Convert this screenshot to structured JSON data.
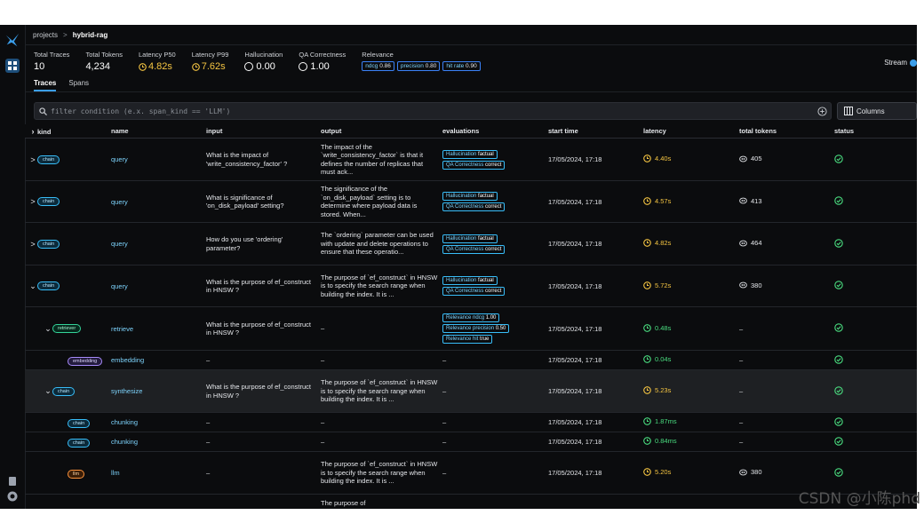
{
  "breadcrumb": {
    "root": "projects",
    "separator": ">",
    "current": "hybrid-rag"
  },
  "stats": [
    {
      "label": "Total Traces",
      "value": "10",
      "icon": "",
      "style": "plain"
    },
    {
      "label": "Total Tokens",
      "value": "4,234",
      "icon": "",
      "style": "plain"
    },
    {
      "label": "Latency P50",
      "value": "4.82s",
      "icon": "clock-icon",
      "style": "warn"
    },
    {
      "label": "Latency P99",
      "value": "7.62s",
      "icon": "clock-icon",
      "style": "warn"
    },
    {
      "label": "Hallucination",
      "value": "0.00",
      "icon": "ring-icon",
      "style": "plain"
    },
    {
      "label": "QA Correctness",
      "value": "1.00",
      "icon": "ring-icon",
      "style": "plain"
    }
  ],
  "relevance": {
    "label": "Relevance",
    "chips": [
      {
        "name": "ndcg",
        "value": "0.86"
      },
      {
        "name": "precision",
        "value": "0.80"
      },
      {
        "name": "hit rate",
        "value": "0.90"
      }
    ]
  },
  "stream_label": "Stream",
  "tabs": [
    {
      "label": "Traces",
      "active": true
    },
    {
      "label": "Spans",
      "active": false
    }
  ],
  "filter": {
    "placeholder": "filter condition (e.x. span_kind == 'LLM')"
  },
  "columns_button": "Columns",
  "table": {
    "headers": [
      "kind",
      "name",
      "input",
      "output",
      "evaluations",
      "start time",
      "latency",
      "total tokens",
      "status"
    ],
    "rows": [
      {
        "indent": 0,
        "caret": ">",
        "kind": "chain",
        "name": "query",
        "input": "What is the impact of 'write_consistency_factor' ?",
        "output": "The impact of the `write_consistency_factor` is that it defines the number of replicas that must ack...",
        "evals": [
          {
            "name": "Hallucination",
            "value": "factual"
          },
          {
            "name": "QA Correctness",
            "value": "correct"
          }
        ],
        "start": "17/05/2024, 17:18",
        "latency": "4.40s",
        "latency_style": "warn",
        "tokens": "405",
        "height": 48
      },
      {
        "indent": 0,
        "caret": ">",
        "kind": "chain",
        "name": "query",
        "input": "What is significance of 'on_disk_payload' setting?",
        "output": "The significance of the `on_disk_payload` setting is to determine where payload data is stored. When...",
        "evals": [
          {
            "name": "Hallucination",
            "value": "factual"
          },
          {
            "name": "QA Correctness",
            "value": "correct"
          }
        ],
        "start": "17/05/2024, 17:18",
        "latency": "4.57s",
        "latency_style": "warn",
        "tokens": "413",
        "height": 47
      },
      {
        "indent": 0,
        "caret": ">",
        "kind": "chain",
        "name": "query",
        "input": "How do you use 'ordering' parameter?",
        "output": "The `ordering` parameter can be used with update and delete operations to ensure that these operatio...",
        "evals": [
          {
            "name": "Hallucination",
            "value": "factual"
          },
          {
            "name": "QA Correctness",
            "value": "correct"
          }
        ],
        "start": "17/05/2024, 17:18",
        "latency": "4.82s",
        "latency_style": "warn",
        "tokens": "464",
        "height": 48
      },
      {
        "indent": 0,
        "caret": "⌄",
        "kind": "chain",
        "name": "query",
        "input": "What is the purpose of ef_construct in HNSW ?",
        "output": "The purpose of `ef_construct` in HNSW is to specify the search range when building the index. It is ...",
        "evals": [
          {
            "name": "Hallucination",
            "value": "factual"
          },
          {
            "name": "QA Correctness",
            "value": "correct"
          }
        ],
        "start": "17/05/2024, 17:18",
        "latency": "5.72s",
        "latency_style": "warn",
        "tokens": "380",
        "height": 47
      },
      {
        "indent": 1,
        "caret": "⌄",
        "kind": "retriever",
        "name": "retrieve",
        "input": "What is the purpose of ef_construct in HNSW ?",
        "output": "–",
        "evals": [
          {
            "name": "Relevance ndcg",
            "value": "1.00"
          },
          {
            "name": "Relevance precision",
            "value": "0.50"
          },
          {
            "name": "Relevance hit",
            "value": "true"
          }
        ],
        "start": "17/05/2024, 17:18",
        "latency": "0.48s",
        "latency_style": "ok",
        "tokens": "–",
        "height": 49
      },
      {
        "indent": 2,
        "caret": "",
        "kind": "embedding",
        "name": "embedding",
        "input": "–",
        "output": "–",
        "evals": [
          {
            "name": "",
            "value": "–"
          }
        ],
        "start": "17/05/2024, 17:18",
        "latency": "0.04s",
        "latency_style": "ok",
        "tokens": "–",
        "height": 22
      },
      {
        "indent": 1,
        "caret": "⌄",
        "kind": "chain",
        "name": "synthesize",
        "input": "What is the purpose of ef_construct in HNSW ?",
        "output": "The purpose of `ef_construct` in HNSW is to specify the search range when building the index. It is ...",
        "evals": [
          {
            "name": "",
            "value": "–"
          }
        ],
        "start": "17/05/2024, 17:18",
        "latency": "5.23s",
        "latency_style": "warn",
        "tokens": "–",
        "height": 48,
        "highlight": true
      },
      {
        "indent": 2,
        "caret": "",
        "kind": "chain",
        "name": "chunking",
        "input": "–",
        "output": "–",
        "evals": [
          {
            "name": "",
            "value": "–"
          }
        ],
        "start": "17/05/2024, 17:18",
        "latency": "1.87ms",
        "latency_style": "ok",
        "tokens": "–",
        "height": 22
      },
      {
        "indent": 2,
        "caret": "",
        "kind": "chain",
        "name": "chunking",
        "input": "–",
        "output": "–",
        "evals": [
          {
            "name": "",
            "value": "–"
          }
        ],
        "start": "17/05/2024, 17:18",
        "latency": "0.84ms",
        "latency_style": "ok",
        "tokens": "–",
        "height": 22
      },
      {
        "indent": 2,
        "caret": "",
        "kind": "llm",
        "name": "llm",
        "input": "–",
        "output": "The purpose of `ef_construct` in HNSW is to specify the search range when building the index. It is ...",
        "evals": [
          {
            "name": "",
            "value": "–"
          }
        ],
        "start": "17/05/2024, 17:18",
        "latency": "5.20s",
        "latency_style": "warn",
        "tokens": "380",
        "height": 48
      },
      {
        "indent": 0,
        "caret": "",
        "kind": "",
        "name": "",
        "input": "",
        "output": "The purpose of",
        "evals": [],
        "start": "",
        "latency": "",
        "latency_style": "warn",
        "tokens": "",
        "height": 20
      }
    ]
  },
  "watermark": "CSDN @小陈phd",
  "colors": {
    "accent": "#3b9eea",
    "link": "#7dd3fc",
    "warn": "#f5c542",
    "ok": "#4ade80",
    "bg": "#0b0c0e"
  }
}
